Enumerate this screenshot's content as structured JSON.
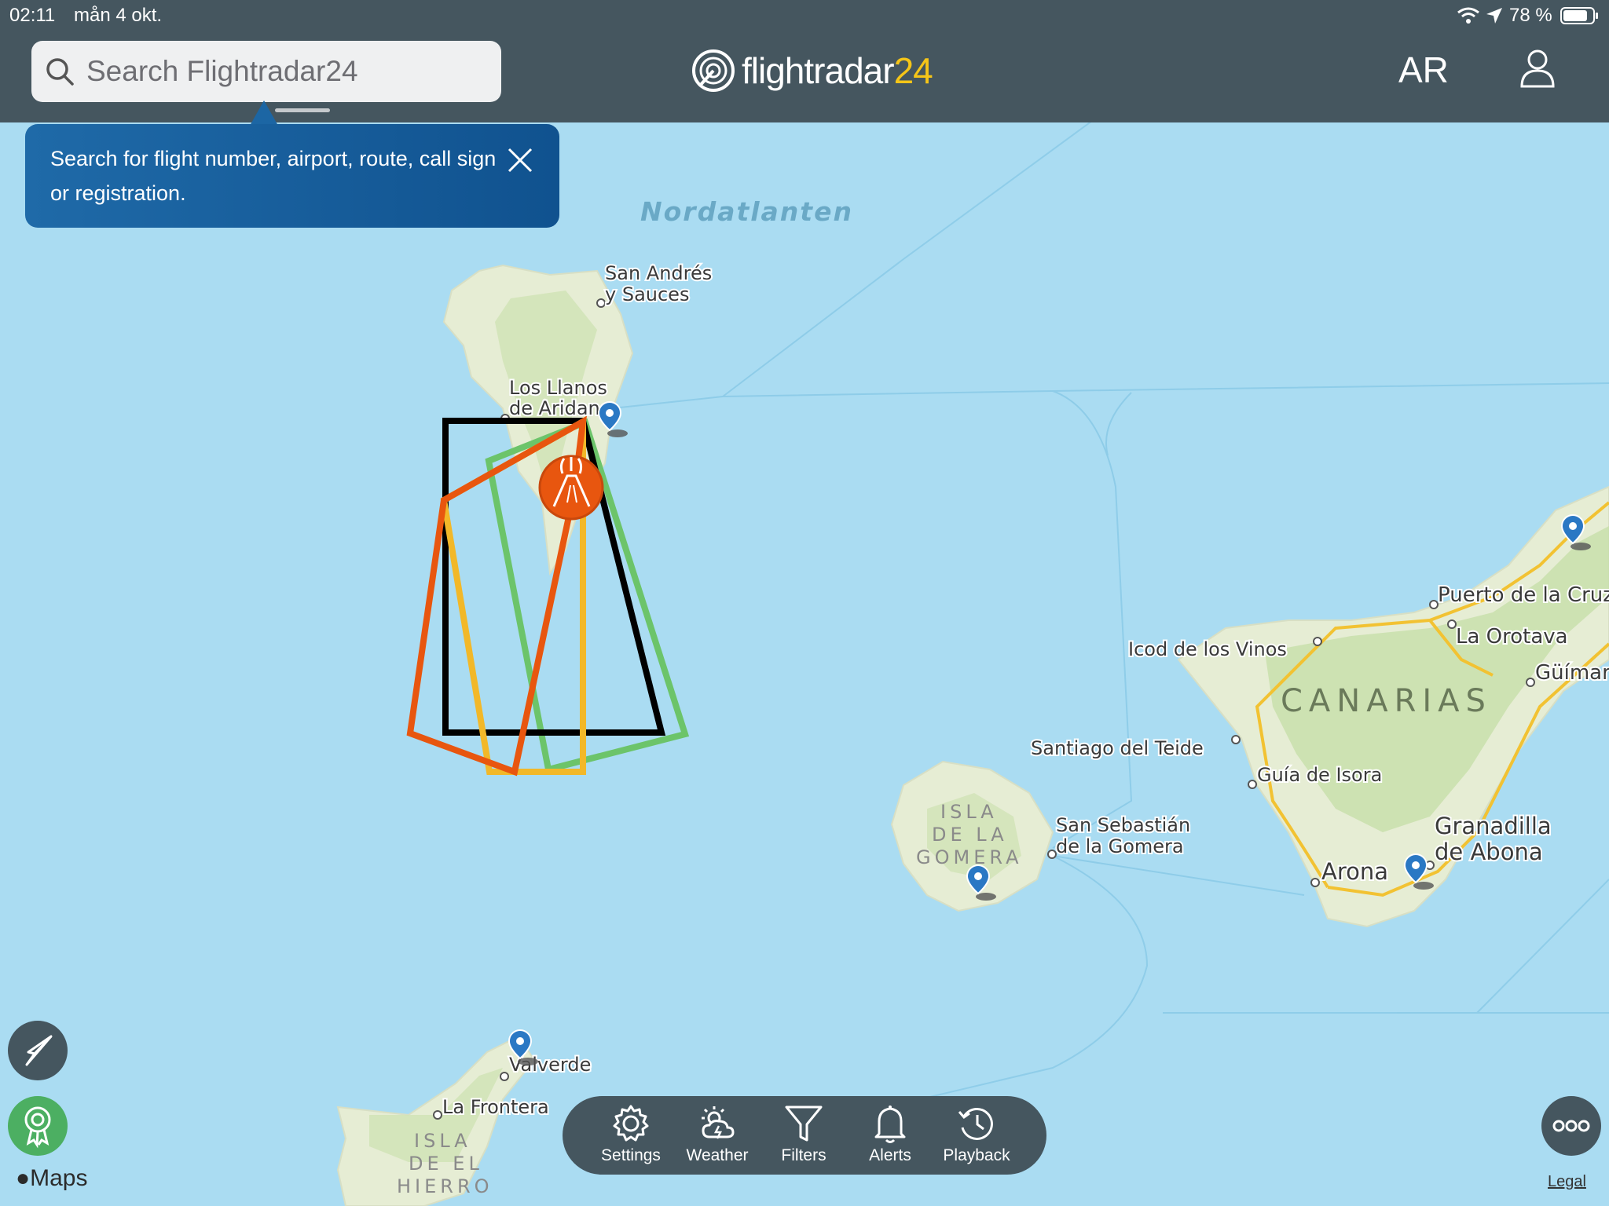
{
  "status_bar": {
    "time": "02:11",
    "date": "mån 4 okt.",
    "battery": "78 %",
    "icons": [
      "wifi-icon",
      "location-arrow-icon",
      "battery-icon"
    ]
  },
  "header": {
    "search_placeholder": "Search Flightradar24",
    "logo_word": "flightradar",
    "logo_number": "24",
    "ar_label": "AR"
  },
  "tooltip": {
    "text": "Search for flight number, airport, route, call sign or registration."
  },
  "map_labels": {
    "ocean": "Nordatlanten",
    "san_andres": [
      "San Andrés",
      "y Sauces"
    ],
    "los_llanos": [
      "Los Llanos",
      "de Aridane"
    ],
    "icod": "Icod de los Vinos",
    "puerto": "Puerto de la Cruz",
    "orotava": "La Orotava",
    "guimar": "Güímar",
    "canarias": "CANARIAS",
    "santiago": "Santiago del Teide",
    "guia": "Guía de Isora",
    "gomera": [
      "ISLA",
      "DE LA",
      "GOMERA"
    ],
    "san_sebastian": [
      "San Sebastián",
      "de la Gomera"
    ],
    "granadilla": [
      "Granadilla",
      "de Abona"
    ],
    "arona": "Arona",
    "valverde": "Valverde",
    "frontera": "La Frontera",
    "hierro": [
      "ISLA",
      "DE EL",
      "HIERRO"
    ]
  },
  "toolbar": {
    "tabs": [
      {
        "label": "Settings",
        "icon": "gear-icon"
      },
      {
        "label": "Weather",
        "icon": "weather-icon"
      },
      {
        "label": "Filters",
        "icon": "filter-icon"
      },
      {
        "label": "Alerts",
        "icon": "bell-icon"
      },
      {
        "label": "Playback",
        "icon": "history-icon"
      }
    ]
  },
  "footer": {
    "maps_label": "Maps",
    "legal_label": "Legal"
  },
  "colors": {
    "header_bg": "#45565f",
    "ocean": "#aadcf2",
    "land": "#e9efd9",
    "tooltip_bg": "#155c9b",
    "volcano": "#e8560f",
    "zone_black": "#000000",
    "zone_orange": "#e8560f",
    "zone_yellow": "#f2b829",
    "zone_green": "#6cc46a",
    "fab_green": "#4caf62",
    "fab_grey": "#45565f"
  }
}
